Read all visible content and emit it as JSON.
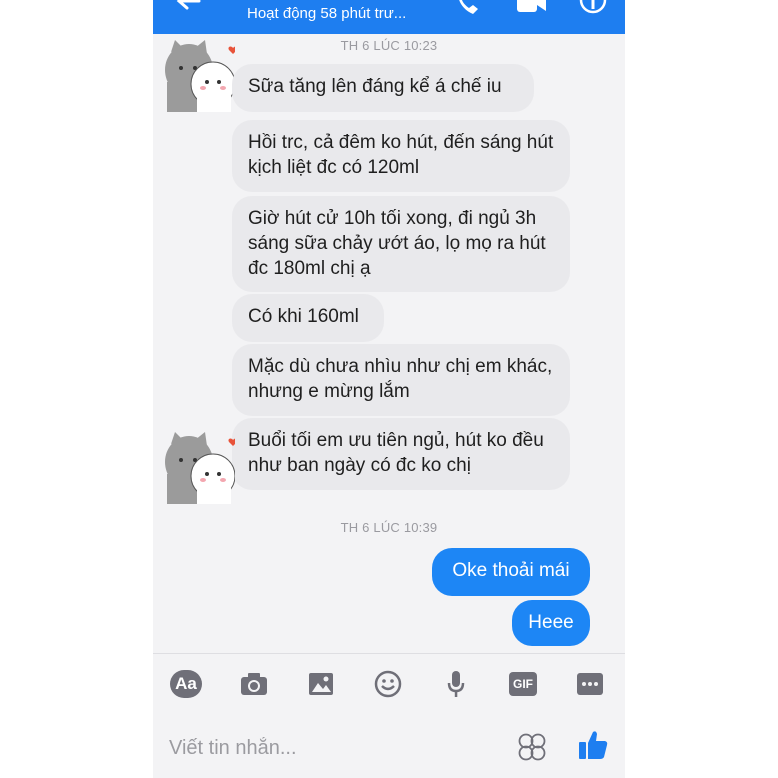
{
  "header": {
    "status": "Hoạt động 58 phút trư..."
  },
  "conversation": {
    "timestamp_1": "TH 6 LÚC 10:23",
    "incoming_group_1": [
      "Sữa tăng lên đáng kể á chế iu",
      "Hồi trc, cả đêm ko hút, đến sáng hút kịch liệt đc có 120ml",
      "Giờ hút cử 10h tối xong, đi ngủ 3h sáng sữa chảy ướt áo, lọ mọ ra hút đc 180ml chị ạ",
      "Có khi 160ml",
      "Mặc dù chưa nhìu như chị em khác, nhưng e mừng lắm",
      "Buổi tối em ưu tiên ngủ, hút ko đều như ban ngày có đc ko chị"
    ],
    "timestamp_2": "TH 6 LÚC 10:39",
    "outgoing": [
      "Oke thoải mái",
      "Heee"
    ]
  },
  "toolbar": {
    "text_format_label": "Aa",
    "gif_label": "GIF"
  },
  "composer": {
    "placeholder": "Viết tin nhắn..."
  },
  "colors": {
    "header": "#1e7ef0",
    "outgoing_bubble": "#1d86f5",
    "incoming_bubble": "#e9e9ec",
    "icon_gray": "#6f6f78",
    "like_blue": "#1e7ef0"
  }
}
